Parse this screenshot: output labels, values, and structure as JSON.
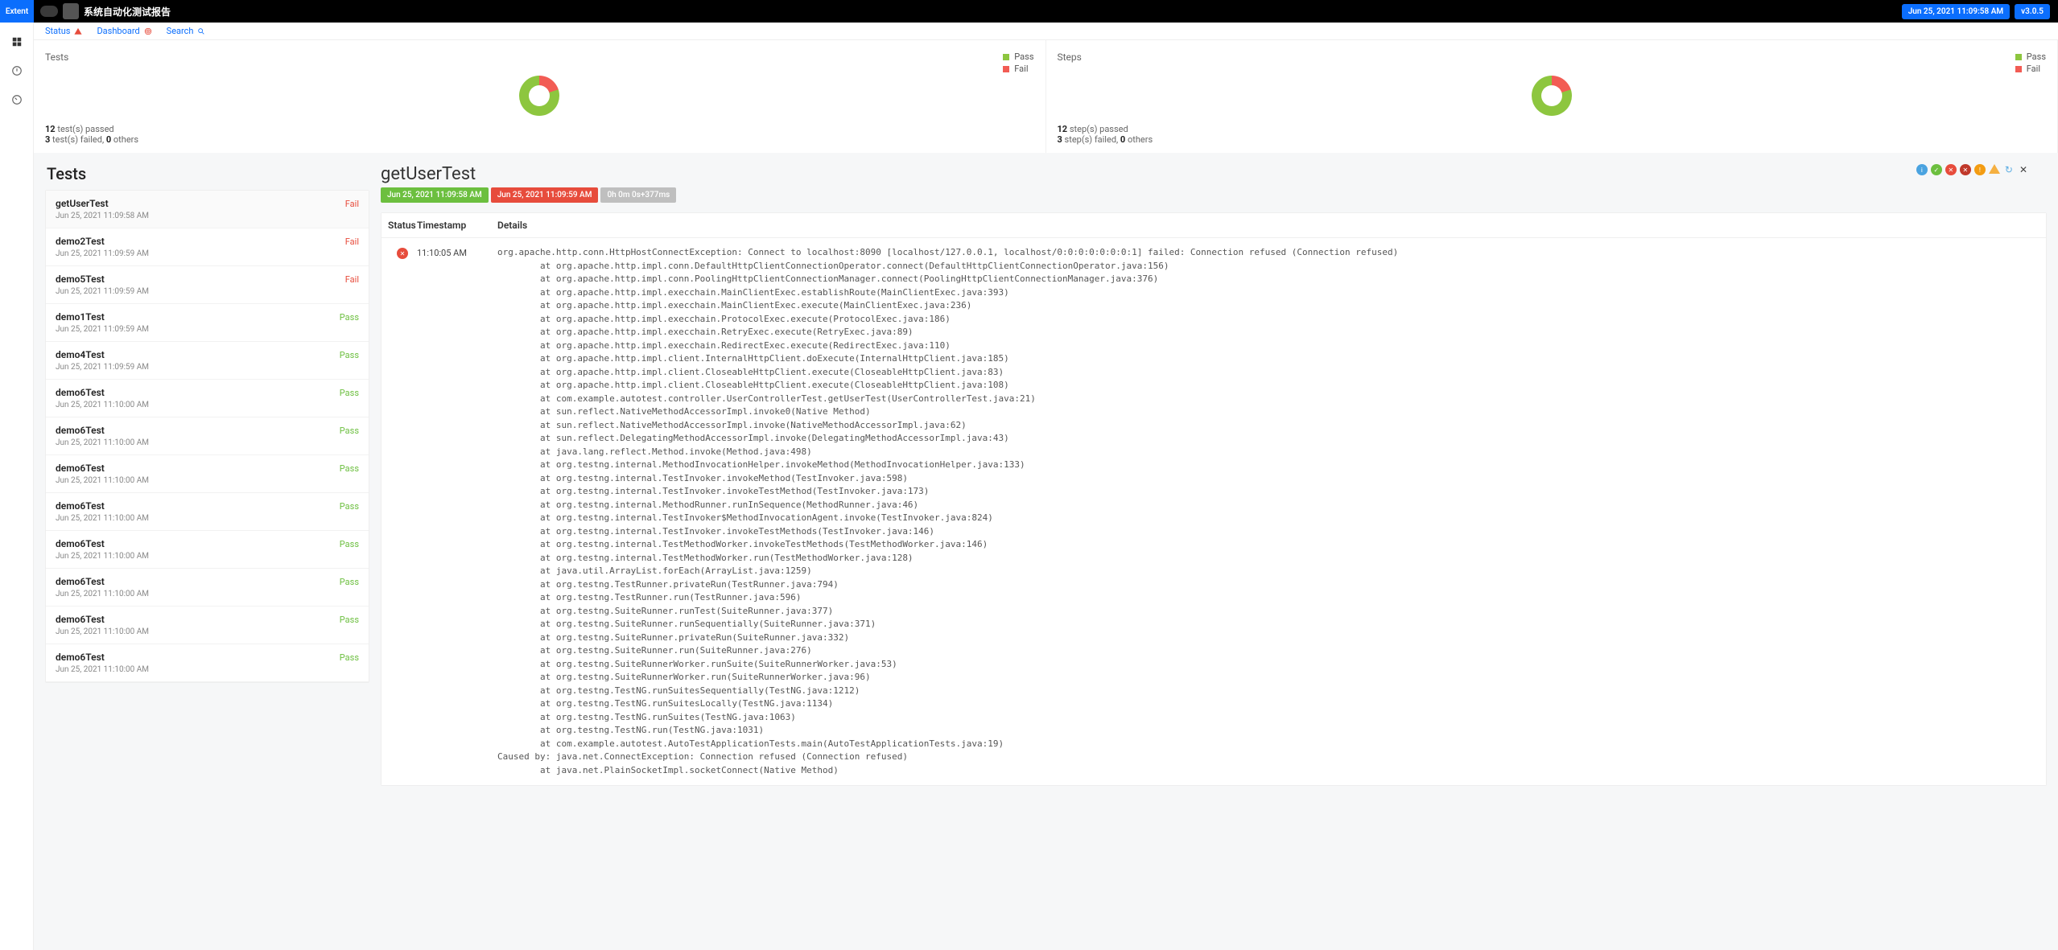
{
  "header": {
    "brand": "Extent",
    "title": "系统自动化测试报告",
    "timestamp": "Jun 25, 2021 11:09:58 AM",
    "version": "v3.0.5"
  },
  "tabs": {
    "status": "Status",
    "dashboard": "Dashboard",
    "search": "Search"
  },
  "summary": {
    "tests": {
      "title": "Tests",
      "legend_pass": "Pass",
      "legend_fail": "Fail",
      "foot_line1_bold": "12",
      "foot_line1_rest": " test(s) passed",
      "foot_line2_bold1": "3",
      "foot_line2_mid": " test(s) failed, ",
      "foot_line2_bold2": "0",
      "foot_line2_end": " others"
    },
    "steps": {
      "title": "Steps",
      "legend_pass": "Pass",
      "legend_fail": "Fail",
      "foot_line1_bold": "12",
      "foot_line1_rest": " step(s) passed",
      "foot_line2_bold1": "3",
      "foot_line2_mid": " step(s) failed, ",
      "foot_line2_bold2": "0",
      "foot_line2_end": " others"
    }
  },
  "tests_panel_title": "Tests",
  "tests": [
    {
      "name": "getUserTest",
      "time": "Jun 25, 2021 11:09:58 AM",
      "status": "Fail",
      "selected": true
    },
    {
      "name": "demo2Test",
      "time": "Jun 25, 2021 11:09:59 AM",
      "status": "Fail"
    },
    {
      "name": "demo5Test",
      "time": "Jun 25, 2021 11:09:59 AM",
      "status": "Fail"
    },
    {
      "name": "demo1Test",
      "time": "Jun 25, 2021 11:09:59 AM",
      "status": "Pass"
    },
    {
      "name": "demo4Test",
      "time": "Jun 25, 2021 11:09:59 AM",
      "status": "Pass"
    },
    {
      "name": "demo6Test",
      "time": "Jun 25, 2021 11:10:00 AM",
      "status": "Pass"
    },
    {
      "name": "demo6Test",
      "time": "Jun 25, 2021 11:10:00 AM",
      "status": "Pass"
    },
    {
      "name": "demo6Test",
      "time": "Jun 25, 2021 11:10:00 AM",
      "status": "Pass"
    },
    {
      "name": "demo6Test",
      "time": "Jun 25, 2021 11:10:00 AM",
      "status": "Pass"
    },
    {
      "name": "demo6Test",
      "time": "Jun 25, 2021 11:10:00 AM",
      "status": "Pass"
    },
    {
      "name": "demo6Test",
      "time": "Jun 25, 2021 11:10:00 AM",
      "status": "Pass"
    },
    {
      "name": "demo6Test",
      "time": "Jun 25, 2021 11:10:00 AM",
      "status": "Pass"
    },
    {
      "name": "demo6Test",
      "time": "Jun 25, 2021 11:10:00 AM",
      "status": "Pass"
    }
  ],
  "detail": {
    "title": "getUserTest",
    "start": "Jun 25, 2021 11:09:58 AM",
    "end": "Jun 25, 2021 11:09:59 AM",
    "duration": "0h 0m 0s+377ms",
    "table": {
      "status": "Status",
      "timestamp": "Timestamp",
      "details": "Details"
    },
    "log_time": "11:10:05 AM",
    "log_text": "org.apache.http.conn.HttpHostConnectException: Connect to localhost:8090 [localhost/127.0.0.1, localhost/0:0:0:0:0:0:0:1] failed: Connection refused (Connection refused)\n        at org.apache.http.impl.conn.DefaultHttpClientConnectionOperator.connect(DefaultHttpClientConnectionOperator.java:156)\n        at org.apache.http.impl.conn.PoolingHttpClientConnectionManager.connect(PoolingHttpClientConnectionManager.java:376)\n        at org.apache.http.impl.execchain.MainClientExec.establishRoute(MainClientExec.java:393)\n        at org.apache.http.impl.execchain.MainClientExec.execute(MainClientExec.java:236)\n        at org.apache.http.impl.execchain.ProtocolExec.execute(ProtocolExec.java:186)\n        at org.apache.http.impl.execchain.RetryExec.execute(RetryExec.java:89)\n        at org.apache.http.impl.execchain.RedirectExec.execute(RedirectExec.java:110)\n        at org.apache.http.impl.client.InternalHttpClient.doExecute(InternalHttpClient.java:185)\n        at org.apache.http.impl.client.CloseableHttpClient.execute(CloseableHttpClient.java:83)\n        at org.apache.http.impl.client.CloseableHttpClient.execute(CloseableHttpClient.java:108)\n        at com.example.autotest.controller.UserControllerTest.getUserTest(UserControllerTest.java:21)\n        at sun.reflect.NativeMethodAccessorImpl.invoke0(Native Method)\n        at sun.reflect.NativeMethodAccessorImpl.invoke(NativeMethodAccessorImpl.java:62)\n        at sun.reflect.DelegatingMethodAccessorImpl.invoke(DelegatingMethodAccessorImpl.java:43)\n        at java.lang.reflect.Method.invoke(Method.java:498)\n        at org.testng.internal.MethodInvocationHelper.invokeMethod(MethodInvocationHelper.java:133)\n        at org.testng.internal.TestInvoker.invokeMethod(TestInvoker.java:598)\n        at org.testng.internal.TestInvoker.invokeTestMethod(TestInvoker.java:173)\n        at org.testng.internal.MethodRunner.runInSequence(MethodRunner.java:46)\n        at org.testng.internal.TestInvoker$MethodInvocationAgent.invoke(TestInvoker.java:824)\n        at org.testng.internal.TestInvoker.invokeTestMethods(TestInvoker.java:146)\n        at org.testng.internal.TestMethodWorker.invokeTestMethods(TestMethodWorker.java:146)\n        at org.testng.internal.TestMethodWorker.run(TestMethodWorker.java:128)\n        at java.util.ArrayList.forEach(ArrayList.java:1259)\n        at org.testng.TestRunner.privateRun(TestRunner.java:794)\n        at org.testng.TestRunner.run(TestRunner.java:596)\n        at org.testng.SuiteRunner.runTest(SuiteRunner.java:377)\n        at org.testng.SuiteRunner.runSequentially(SuiteRunner.java:371)\n        at org.testng.SuiteRunner.privateRun(SuiteRunner.java:332)\n        at org.testng.SuiteRunner.run(SuiteRunner.java:276)\n        at org.testng.SuiteRunnerWorker.runSuite(SuiteRunnerWorker.java:53)\n        at org.testng.SuiteRunnerWorker.run(SuiteRunnerWorker.java:96)\n        at org.testng.TestNG.runSuitesSequentially(TestNG.java:1212)\n        at org.testng.TestNG.runSuitesLocally(TestNG.java:1134)\n        at org.testng.TestNG.runSuites(TestNG.java:1063)\n        at org.testng.TestNG.run(TestNG.java:1031)\n        at com.example.autotest.AutoTestApplicationTests.main(AutoTestApplicationTests.java:19)\nCaused by: java.net.ConnectException: Connection refused (Connection refused)\n        at java.net.PlainSocketImpl.socketConnect(Native Method)"
  },
  "chart_data": [
    {
      "type": "pie",
      "title": "Tests",
      "series": [
        {
          "name": "Pass",
          "value": 12,
          "color": "#8dc63f"
        },
        {
          "name": "Fail",
          "value": 3,
          "color": "#f25c54"
        }
      ]
    },
    {
      "type": "pie",
      "title": "Steps",
      "series": [
        {
          "name": "Pass",
          "value": 12,
          "color": "#8dc63f"
        },
        {
          "name": "Fail",
          "value": 3,
          "color": "#f25c54"
        }
      ]
    }
  ]
}
